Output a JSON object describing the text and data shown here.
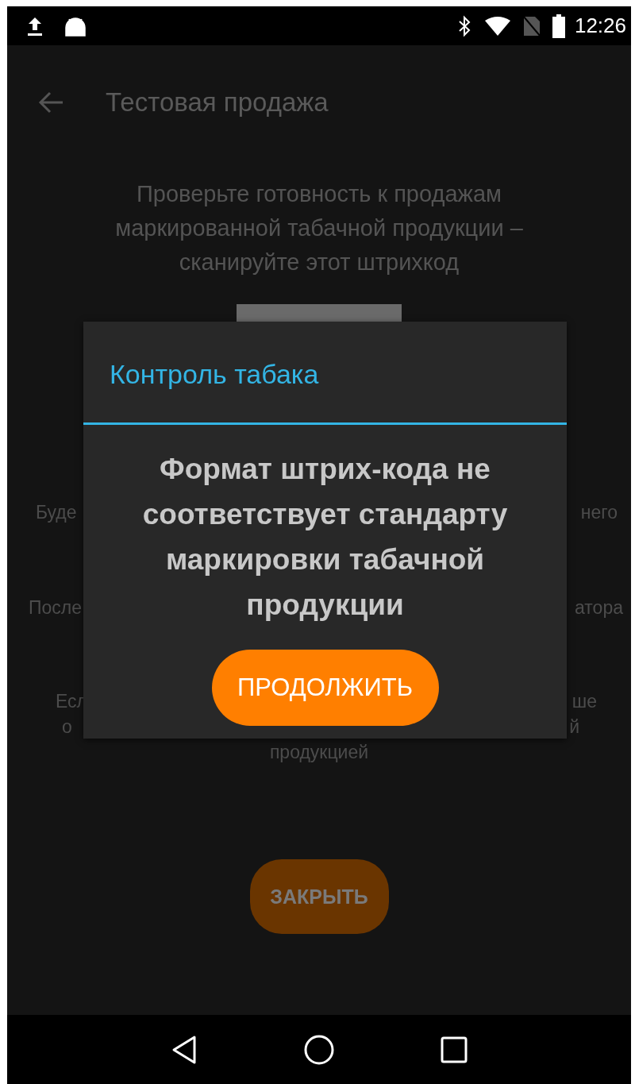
{
  "status_bar": {
    "time": "12:26"
  },
  "app_bar": {
    "title": "Тестовая продажа"
  },
  "instruction": [
    "Проверьте готовность к продажам",
    "маркированной табачной продукции –",
    "сканируйте этот штрихкод"
  ],
  "partial_lines": [
    {
      "left": "Буде",
      "right": "него"
    },
    {
      "left": "После",
      "right": "атора"
    },
    {
      "left": "Есл",
      "right": "ше"
    },
    {
      "left": "о",
      "right": "й"
    }
  ],
  "last_line": "продукцией",
  "close_button": "ЗАКРЫТЬ",
  "dialog": {
    "title": "Контроль табака",
    "message": [
      "Формат штрих-кода не",
      "соответствует стандарту",
      "маркировки табачной",
      "продукции"
    ],
    "button": "ПРОДОЛЖИТЬ"
  }
}
